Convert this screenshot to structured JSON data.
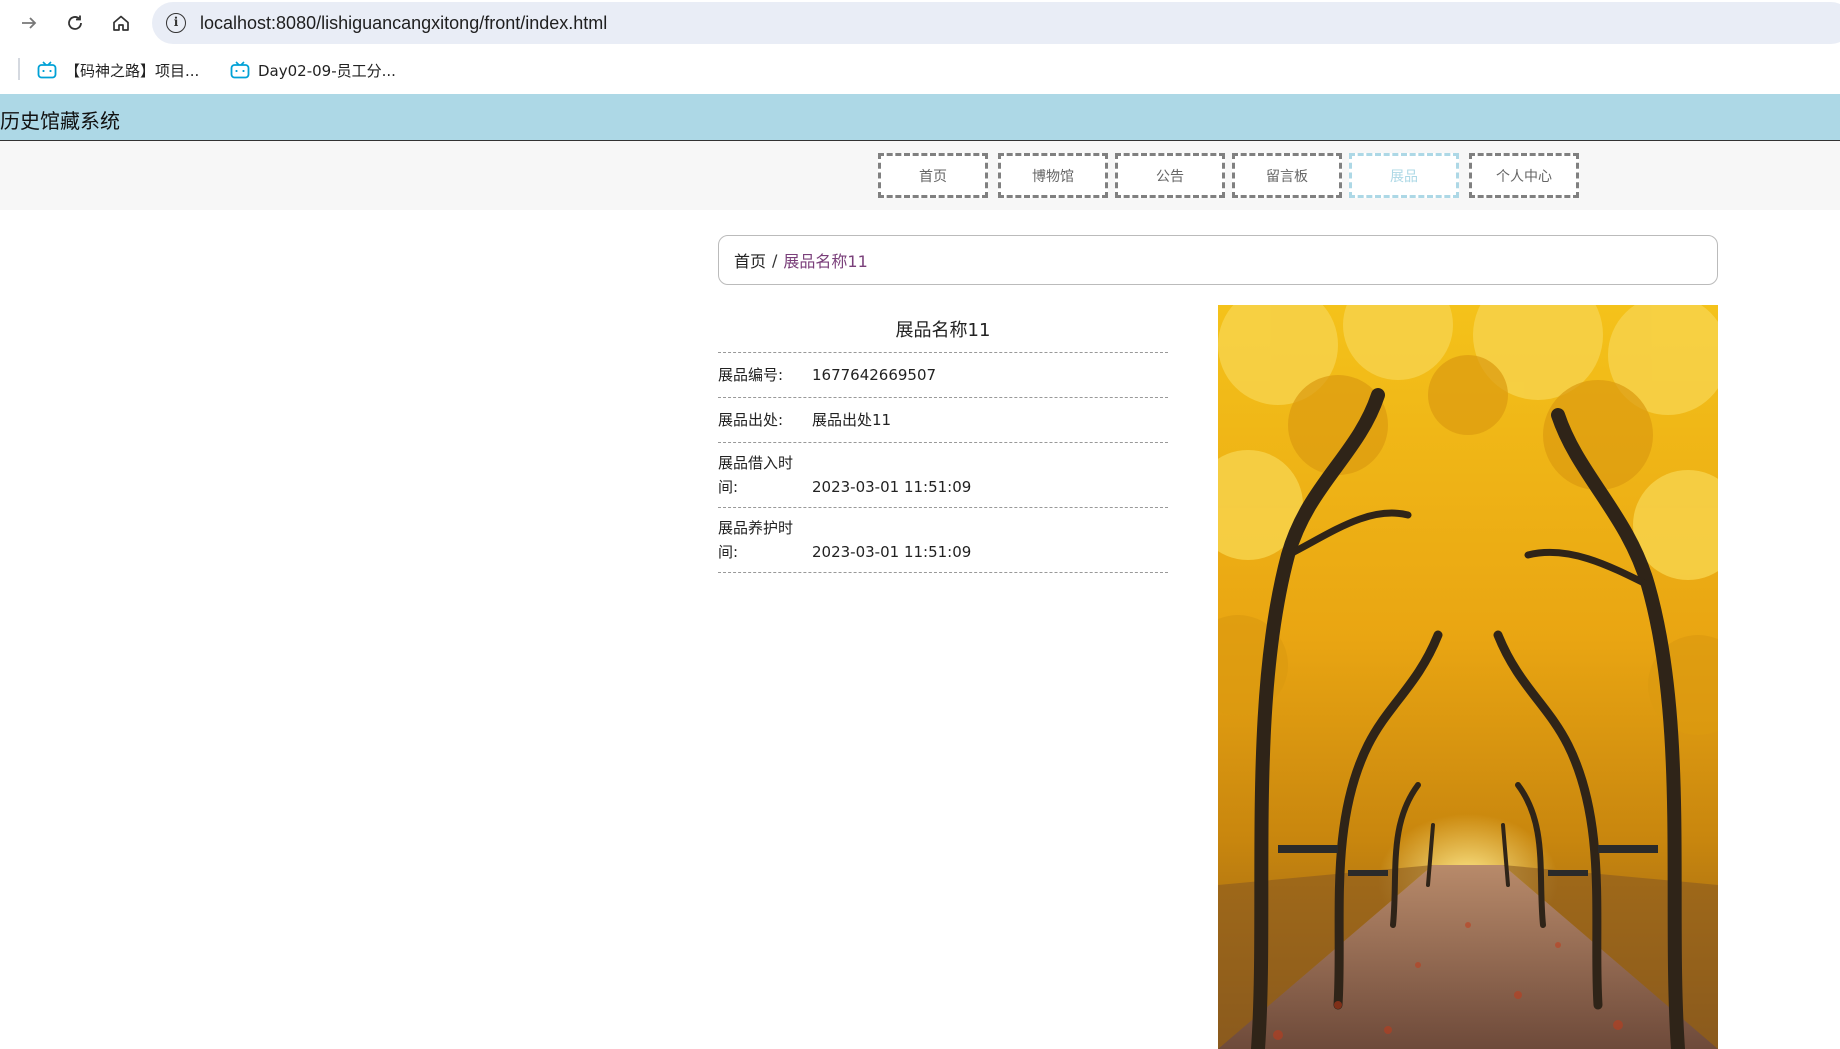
{
  "browser": {
    "url": "localhost:8080/lishiguancangxitong/front/index.html",
    "bookmarks": [
      {
        "label": "【码神之路】项目..."
      },
      {
        "label": "Day02-09-员工分..."
      }
    ]
  },
  "site": {
    "title": "历史馆藏系统",
    "menu": [
      {
        "label": "首页"
      },
      {
        "label": "博物馆"
      },
      {
        "label": "公告"
      },
      {
        "label": "留言板"
      },
      {
        "label": "展品"
      },
      {
        "label": "个人中心"
      }
    ],
    "active_color": "#add8e6",
    "header_color": "#add8e6"
  },
  "breadcrumb": {
    "home": "首页",
    "separator": "/",
    "current": "展品名称11"
  },
  "detail": {
    "title": "展品名称11",
    "fields": [
      {
        "label": "展品编号:",
        "value": "1677642669507"
      },
      {
        "label": "展品出处:",
        "value": "展品出处11"
      },
      {
        "label": "展品借入时间:",
        "value": "2023-03-01 11:51:09"
      },
      {
        "label": "展品养护时间:",
        "value": "2023-03-01 11:51:09"
      }
    ],
    "image": {
      "subject": "autumn tree-lined park path with golden leaves"
    }
  }
}
